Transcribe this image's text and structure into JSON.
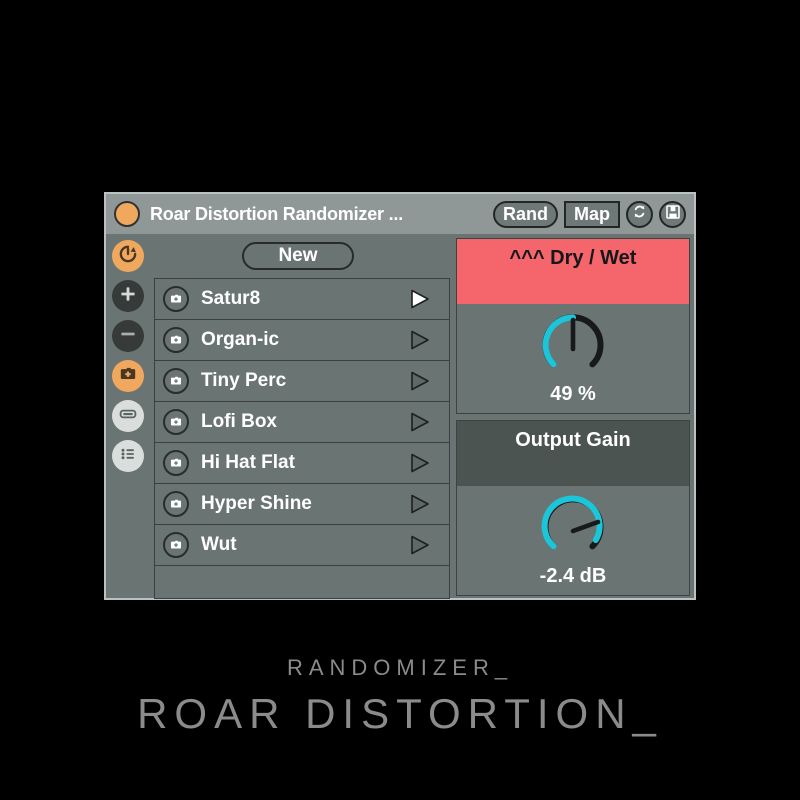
{
  "window": {
    "title": "Roar Distortion Randomizer ...",
    "device_dot_color": "#f0a85e",
    "titlebar_bg": "#8f9896",
    "body_bg": "#6a7472"
  },
  "titlebar": {
    "rand_label": "Rand",
    "map_label": "Map",
    "refresh_icon": "refresh-sync-icon",
    "save_icon": "floppy-save-icon"
  },
  "rail": {
    "items": [
      {
        "name": "randomize-icon",
        "style": "orange"
      },
      {
        "name": "add-icon",
        "style": "dark"
      },
      {
        "name": "remove-icon",
        "style": "dark"
      },
      {
        "name": "snapshot-camera-icon",
        "style": "orange"
      },
      {
        "name": "fader-icon",
        "style": "light"
      },
      {
        "name": "list-icon",
        "style": "light"
      }
    ]
  },
  "presets": {
    "new_label": "New",
    "rows": [
      {
        "label": "Satur8",
        "play": "filled"
      },
      {
        "label": "Organ-ic",
        "play": "outline"
      },
      {
        "label": "Tiny Perc",
        "play": "outline"
      },
      {
        "label": "Lofi Box",
        "play": "outline"
      },
      {
        "label": "Hi Hat Flat",
        "play": "outline"
      },
      {
        "label": "Hyper Shine",
        "play": "outline"
      },
      {
        "label": "Wut",
        "play": "outline"
      }
    ]
  },
  "params": [
    {
      "title": "^^^ Dry / Wet",
      "value": "49 %",
      "header_color": "#f4666b",
      "arc_color": "#1cc5d8",
      "fill_ratio": 0.49,
      "pointer_deg": 0
    },
    {
      "title": "Output Gain",
      "value": "-2.4 dB",
      "header_color": "#4c5452",
      "arc_color": "#1cc5d8",
      "fill_ratio": 0.87,
      "pointer_deg": 115
    }
  ],
  "caption": {
    "sub": "RANDOMIZER_",
    "main": "ROAR DISTORTION_"
  }
}
